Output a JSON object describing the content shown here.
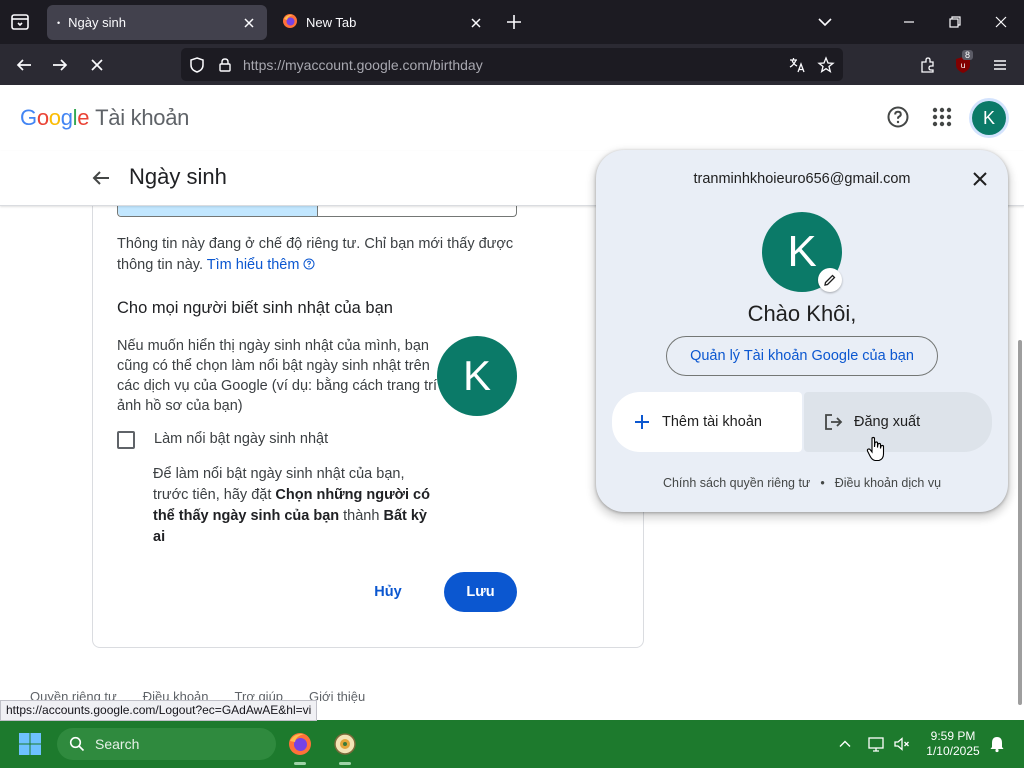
{
  "browser": {
    "tabs": [
      {
        "label": "Ngày sinh",
        "active": true
      },
      {
        "label": "New Tab",
        "active": false
      }
    ],
    "url_host": "https://myaccount.google.com",
    "url_path": "/birthday",
    "extension_badge": "8",
    "status_url": "https://accounts.google.com/Logout?ec=GAdAwAE&hl=vi"
  },
  "header": {
    "logo_word": "Google",
    "product": "Tài khoản",
    "avatar_letter": "K"
  },
  "page": {
    "title": "Ngày sinh",
    "privacy_text": "Thông tin này đang ở chế độ riêng tư. Chỉ bạn mới thấy được thông tin này.",
    "learn_more": "Tìm hiểu thêm",
    "section_title": "Cho mọi người biết sinh nhật của bạn",
    "section_desc": "Nếu muốn hiển thị ngày sinh nhật của mình, bạn cũng có thể chọn làm nổi bật ngày sinh nhật trên các dịch vụ của Google (ví dụ: bằng cách trang trí ảnh hồ sơ của bạn)",
    "avatar_letter": "K",
    "checkbox_label": "Làm nổi bật ngày sinh nhật",
    "checkbox_checked": false,
    "hint_pre": "Để làm nổi bật ngày sinh nhật của bạn, trước tiên, hãy đặt ",
    "hint_bold1": "Chọn những người có thể thấy ngày sinh của bạn",
    "hint_mid": " thành ",
    "hint_bold2": "Bất kỳ ai",
    "cancel_label": "Hủy",
    "save_label": "Lưu"
  },
  "footer": {
    "links": [
      "Quyền riêng tư",
      "Điều khoản",
      "Trợ giúp",
      "Giới thiệu"
    ]
  },
  "account_popup": {
    "email": "tranminhkhoieuro656@gmail.com",
    "avatar_letter": "K",
    "greeting": "Chào Khôi,",
    "manage_label": "Quản lý Tài khoản Google của bạn",
    "add_account_label": "Thêm tài khoản",
    "sign_out_label": "Đăng xuất",
    "privacy_policy": "Chính sách quyền riêng tư",
    "separator": "•",
    "terms": "Điều khoản dịch vụ"
  },
  "taskbar": {
    "search_placeholder": "Search",
    "time": "9:59 PM",
    "date": "1/10/2025"
  },
  "colors": {
    "avatar": "#0b7a68",
    "accent": "#0b57d0",
    "taskbar": "#1d7a2d",
    "popup_bg": "#e9eef6"
  }
}
